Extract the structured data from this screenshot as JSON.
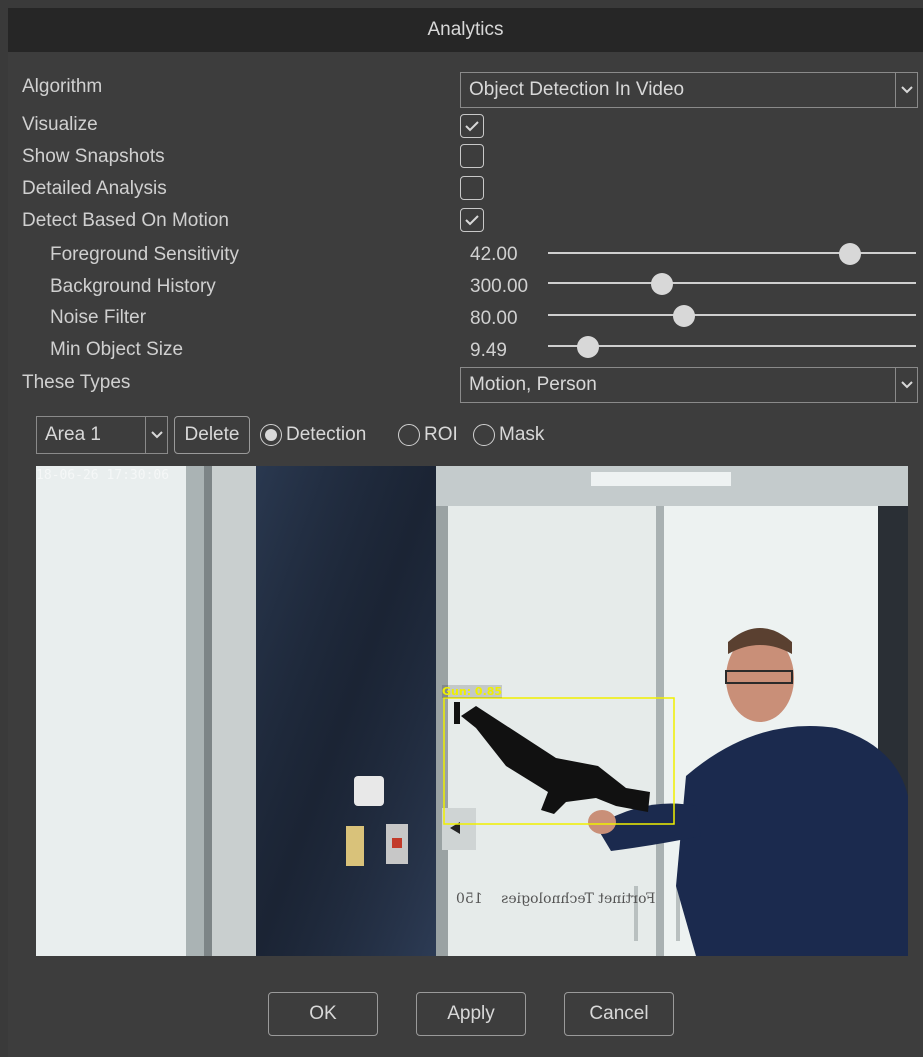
{
  "window": {
    "title": "Analytics"
  },
  "form": {
    "algorithm_label": "Algorithm",
    "algorithm_value": "Object Detection In Video",
    "visualize_label": "Visualize",
    "visualize_checked": true,
    "show_snapshots_label": "Show Snapshots",
    "show_snapshots_checked": false,
    "detailed_analysis_label": "Detailed Analysis",
    "detailed_analysis_checked": false,
    "detect_motion_label": "Detect Based On Motion",
    "detect_motion_checked": true,
    "sliders": [
      {
        "label": "Foreground Sensitivity",
        "value": "42.00",
        "position": 0.82
      },
      {
        "label": "Background History",
        "value": "300.00",
        "position": 0.31
      },
      {
        "label": "Noise Filter",
        "value": "80.00",
        "position": 0.37
      },
      {
        "label": "Min Object Size",
        "value": "9.49",
        "position": 0.11
      }
    ],
    "types_label": "These Types",
    "types_value": "Motion, Person"
  },
  "area_bar": {
    "area_value": "Area 1",
    "delete_label": "Delete",
    "radio_detection": "Detection",
    "radio_roi": "ROI",
    "radio_mask": "Mask",
    "selected": "Detection"
  },
  "video": {
    "timestamp": "18-06-26 17:30:06",
    "detection_label": "Gun: 0.85",
    "wall_text": "Fortinet Technologies",
    "wall_text_number": "150"
  },
  "footer": {
    "ok_label": "OK",
    "apply_label": "Apply",
    "cancel_label": "Cancel"
  },
  "colors": {
    "detection_box": "#f0f000",
    "background": "#3d3d3d",
    "titlebar": "#262626"
  }
}
